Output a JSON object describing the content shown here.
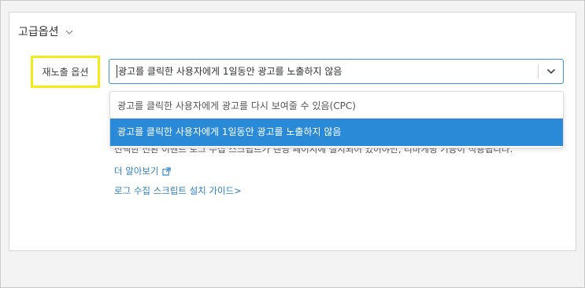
{
  "section": {
    "title": "고급옵션",
    "toggle_icon": "chevron-down-icon"
  },
  "remarketing": {
    "label": "재노출 옵션",
    "highlight_color": "#f4ea16",
    "selected_value": "광고를 클릭한 사용자에게 1일동안 광고를 노출하지 않음",
    "options": [
      "광고를 클릭한 사용자에게 광고를 다시 보여줄 수 있음(CPC)",
      "광고를 클릭한 사용자에게 1일동안 광고를 노출하지 않음"
    ],
    "selected_index": 1,
    "help_text": "선택한 전환 이벤트 로그 수집 스크립트가 랜딩 페이지에 설치되어 있어야만, 리마케팅 기능이 적용됩니다.",
    "learn_more": "더 알아보기",
    "guide_link": "로그 수집 스크립트 설치 가이드>"
  },
  "colors": {
    "accent": "#2b8ad8",
    "focus_border": "#3f98d6",
    "link": "#2b82c9"
  }
}
